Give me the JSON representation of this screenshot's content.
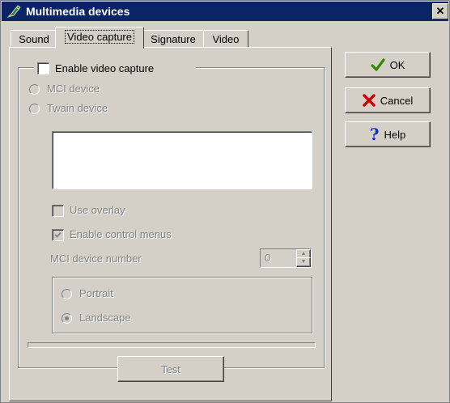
{
  "window": {
    "title": "Multimedia devices"
  },
  "tabs": [
    {
      "label": "Sound"
    },
    {
      "label": "Video capture"
    },
    {
      "label": "Signature"
    },
    {
      "label": "Video"
    }
  ],
  "capture": {
    "enable_label": "Enable video capture",
    "mci_label": "MCI device",
    "twain_label": "Twain device",
    "use_overlay_label": "Use overlay",
    "enable_menus_label": "Enable control menus",
    "device_number_label": "MCI device number",
    "device_number_value": "0",
    "portrait_label": "Portrait",
    "landscape_label": "Landscape",
    "test_label": "Test"
  },
  "buttons": {
    "ok_label": "OK",
    "cancel_label": "Cancel",
    "help_label": "Help"
  },
  "colors": {
    "titlebar": "#0a2466",
    "ok_icon": "#2e8b00",
    "cancel_icon": "#cc0000",
    "help_icon": "#1030c0"
  }
}
